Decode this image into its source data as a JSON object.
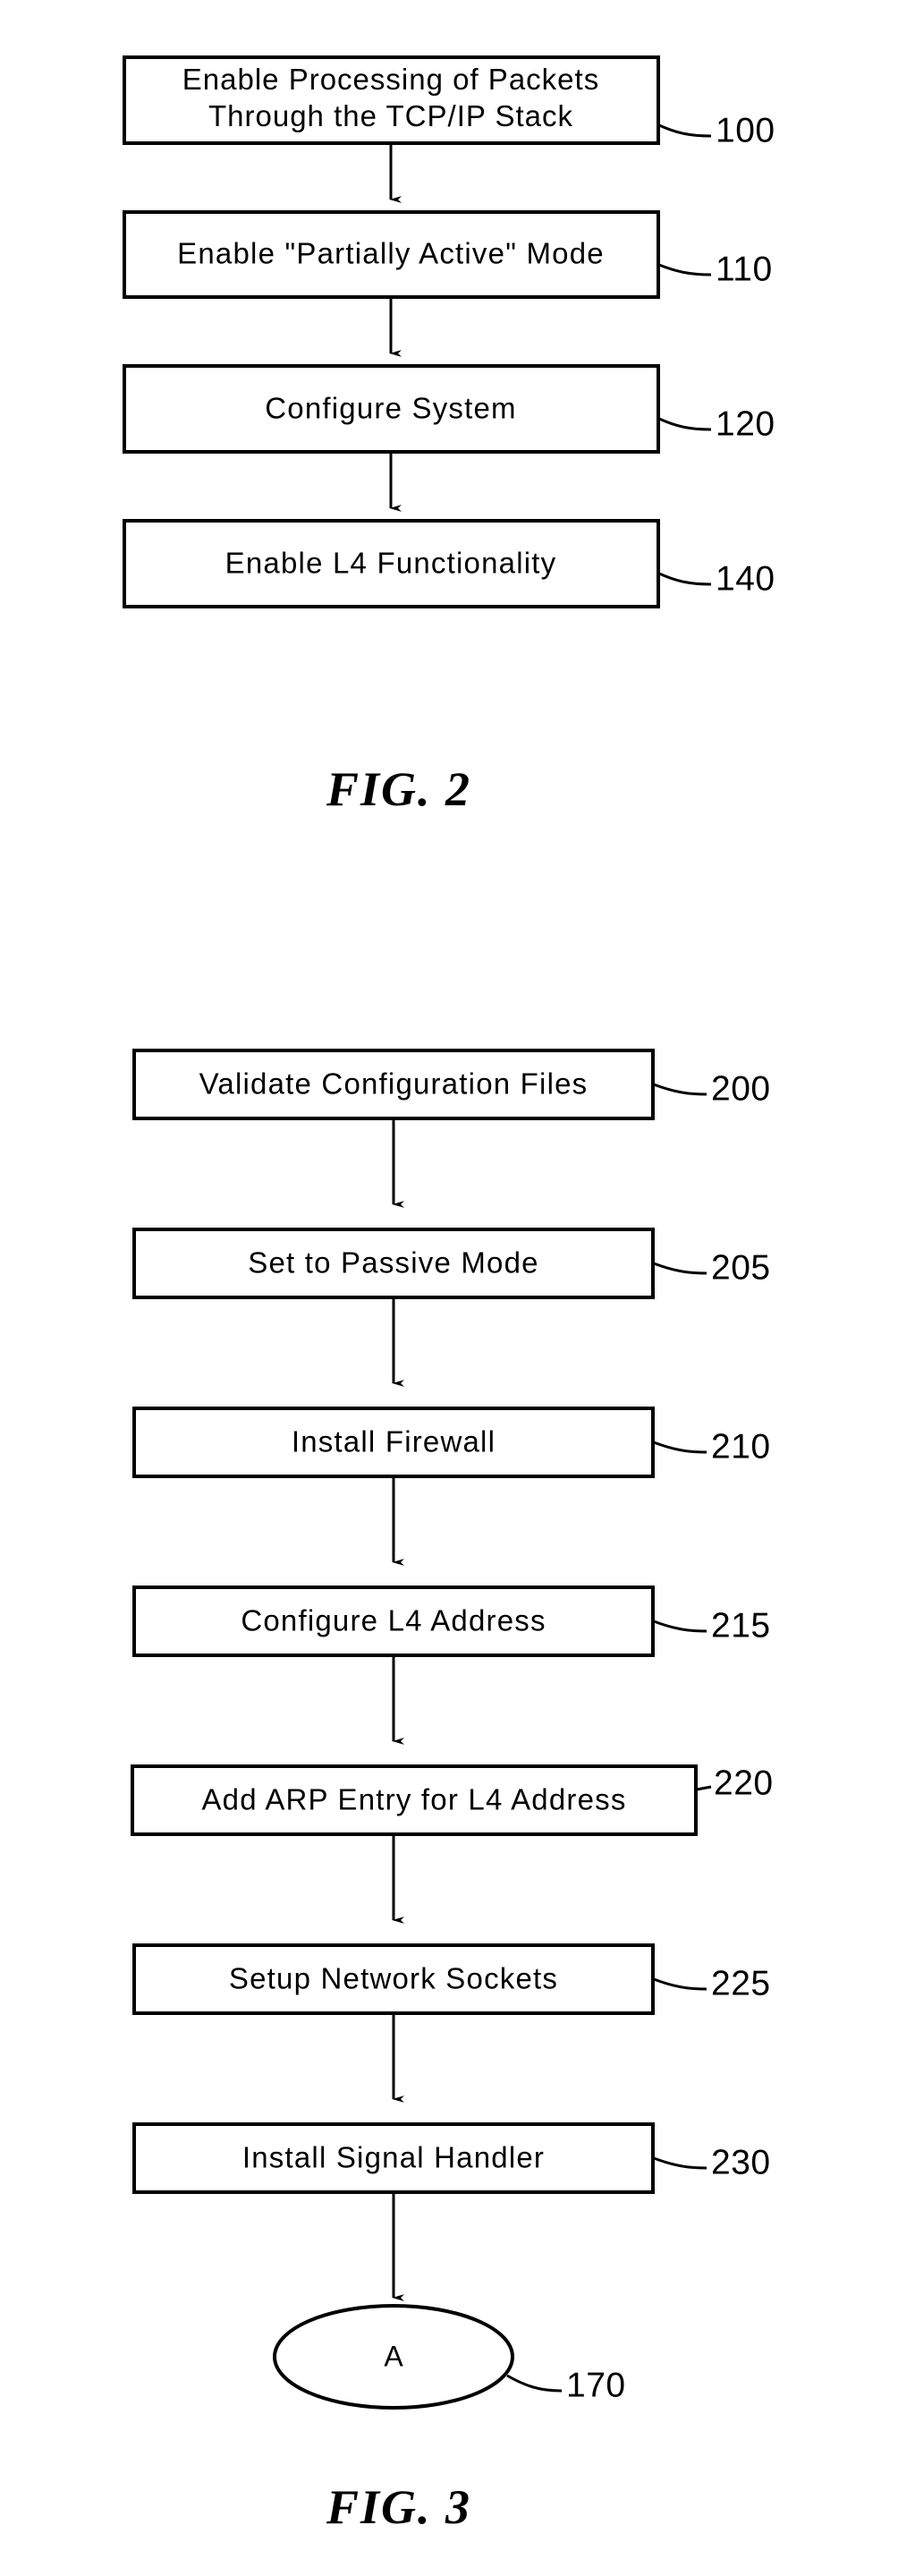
{
  "document": {
    "type": "patent-drawing-sheet",
    "figures": [
      {
        "id": "fig2",
        "caption": "FIG.   2",
        "nodes": [
          {
            "id": "n100",
            "shape": "rect",
            "lines": [
              "Enable Processing of Packets",
              "Through the TCP/IP Stack"
            ],
            "ref": "100"
          },
          {
            "id": "n110",
            "shape": "rect",
            "lines": [
              "Enable \"Partially Active\" Mode"
            ],
            "ref": "110"
          },
          {
            "id": "n120",
            "shape": "rect",
            "lines": [
              "Configure System"
            ],
            "ref": "120"
          },
          {
            "id": "n140",
            "shape": "rect",
            "lines": [
              "Enable L4 Functionality"
            ],
            "ref": "140"
          }
        ]
      },
      {
        "id": "fig3",
        "caption": "FIG.   3",
        "nodes": [
          {
            "id": "n200",
            "shape": "rect",
            "lines": [
              "Validate Configuration Files"
            ],
            "ref": "200"
          },
          {
            "id": "n205",
            "shape": "rect",
            "lines": [
              "Set to Passive Mode"
            ],
            "ref": "205"
          },
          {
            "id": "n210",
            "shape": "rect",
            "lines": [
              "Install Firewall"
            ],
            "ref": "210"
          },
          {
            "id": "n215",
            "shape": "rect",
            "lines": [
              "Configure L4 Address"
            ],
            "ref": "215"
          },
          {
            "id": "n220",
            "shape": "rect",
            "lines": [
              "Add ARP Entry for L4 Address"
            ],
            "ref": "220"
          },
          {
            "id": "n225",
            "shape": "rect",
            "lines": [
              "Setup Network Sockets"
            ],
            "ref": "225"
          },
          {
            "id": "n230",
            "shape": "rect",
            "lines": [
              "Install Signal Handler"
            ],
            "ref": "230"
          },
          {
            "id": "n170",
            "shape": "ellipse",
            "lines": [
              "A"
            ],
            "ref": "170"
          }
        ]
      }
    ],
    "colors": {
      "ink": "#000000",
      "paper": "#ffffff"
    }
  },
  "fig2": {
    "caption": "FIG.   2",
    "box100": {
      "line1": "Enable Processing of Packets",
      "line2": "Through the TCP/IP Stack",
      "ref": "100"
    },
    "box110": {
      "line1": "Enable \"Partially Active\" Mode",
      "ref": "110"
    },
    "box120": {
      "line1": "Configure System",
      "ref": "120"
    },
    "box140": {
      "line1": "Enable L4 Functionality",
      "ref": "140"
    }
  },
  "fig3": {
    "caption": "FIG.   3",
    "box200": {
      "line1": "Validate Configuration Files",
      "ref": "200"
    },
    "box205": {
      "line1": "Set to Passive Mode",
      "ref": "205"
    },
    "box210": {
      "line1": "Install Firewall",
      "ref": "210"
    },
    "box215": {
      "line1": "Configure L4 Address",
      "ref": "215"
    },
    "box220": {
      "line1": "Add ARP Entry for L4 Address",
      "ref": "220"
    },
    "box225": {
      "line1": "Setup Network Sockets",
      "ref": "225"
    },
    "box230": {
      "line1": "Install Signal Handler",
      "ref": "230"
    },
    "terminator170": {
      "label": "A",
      "ref": "170"
    }
  }
}
